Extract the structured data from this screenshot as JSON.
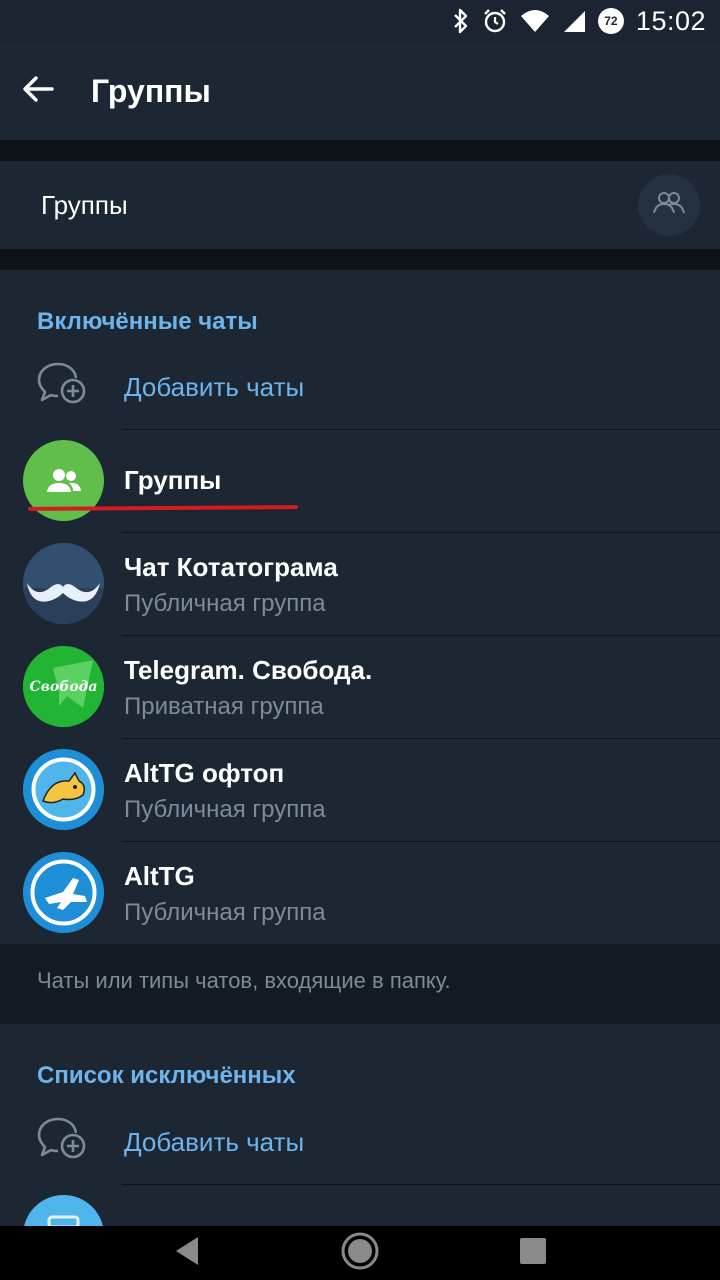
{
  "status_bar": {
    "time": "15:02",
    "battery_level": "72",
    "icons": [
      "bluetooth-icon",
      "alarm-icon",
      "wifi-icon",
      "signal-icon",
      "battery-icon"
    ]
  },
  "app_bar": {
    "title": "Группы",
    "back_icon": "arrow-left-icon"
  },
  "folder_name": {
    "value": "Группы",
    "emoji_icon": "groups-icon"
  },
  "included": {
    "header": "Включённые чаты",
    "add_label": "Добавить чаты",
    "chats": [
      {
        "title": "Группы",
        "subtitle": "",
        "avatar": "groups-type-avatar",
        "avatar_color": "#5fbf4a"
      },
      {
        "title": "Чат Котатограма",
        "subtitle": "Публичная группа",
        "avatar": "mustache-avatar"
      },
      {
        "title": "Telegram. Свобода.",
        "subtitle": "Приватная группа",
        "avatar": "svoboda-avatar",
        "avatar_text": "Свобода"
      },
      {
        "title": "AltTG офтоп",
        "subtitle": "Публичная группа",
        "avatar": "cat-avatar"
      },
      {
        "title": "AltTG",
        "subtitle": "Публичная группа",
        "avatar": "plane-avatar"
      }
    ]
  },
  "hint": "Чаты или типы чатов, входящие в папку.",
  "excluded": {
    "header": "Список исключённых",
    "add_label": "Добавить чаты"
  },
  "colors": {
    "accent": "#6db3ec",
    "background": "#1d2733",
    "separator": "#0f1318",
    "subtitle": "#7d8b99",
    "annotation_red": "#d21e22"
  }
}
